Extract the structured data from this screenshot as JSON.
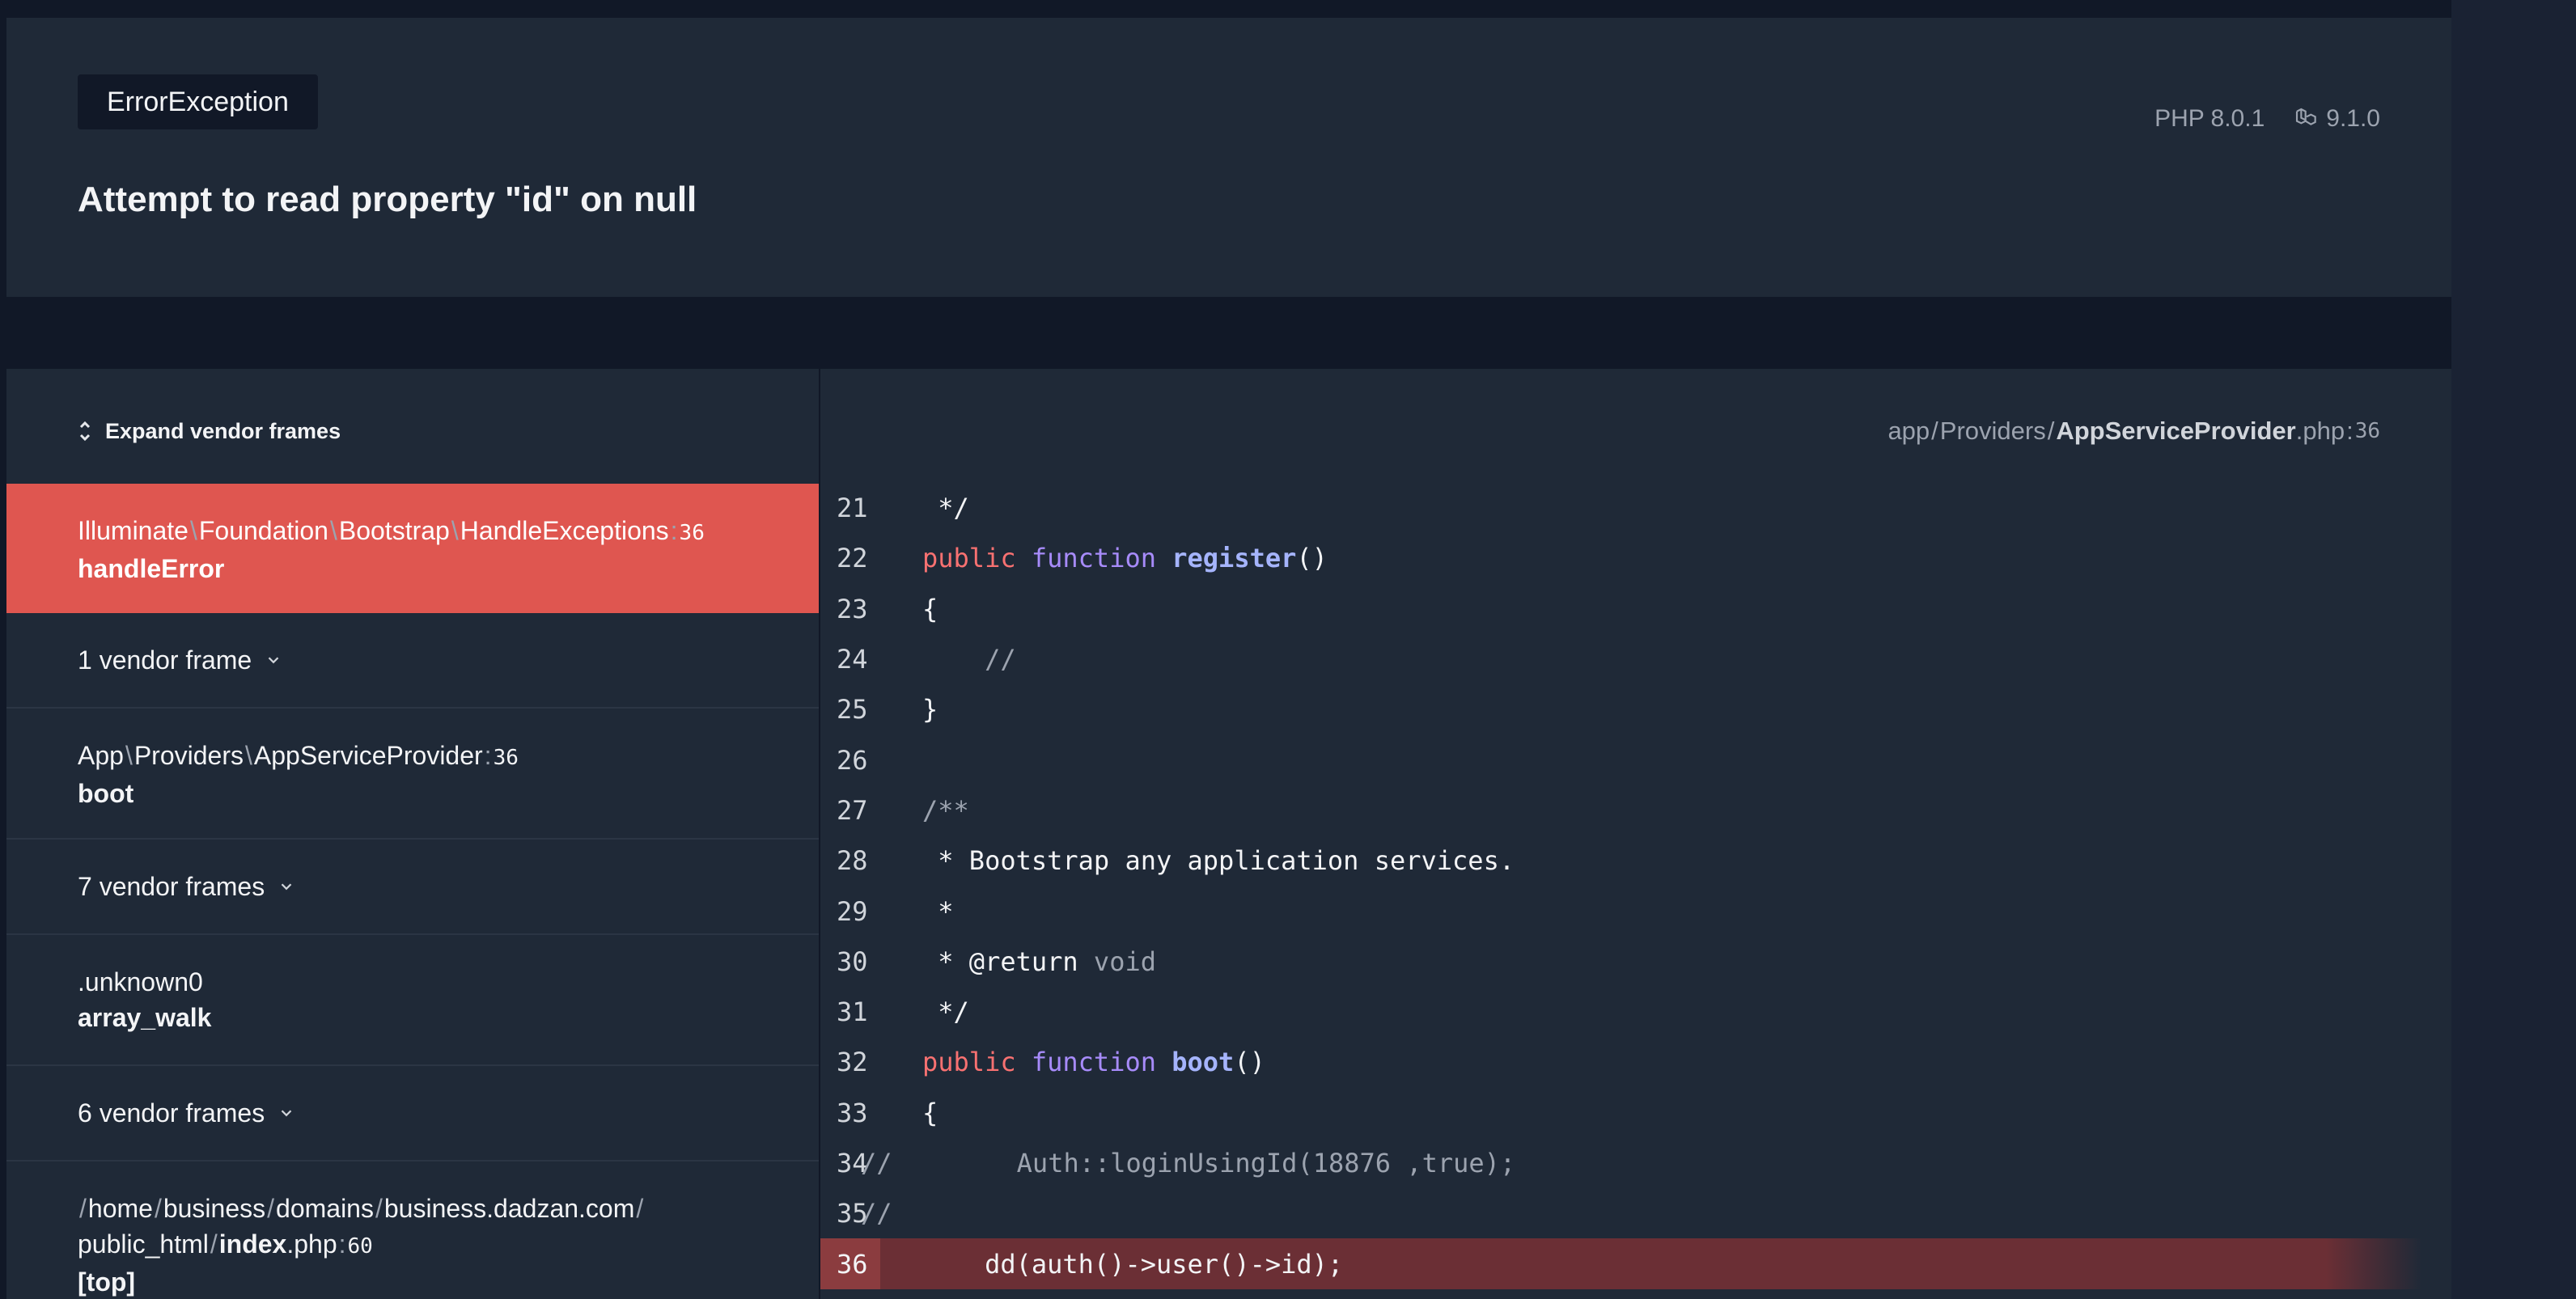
{
  "header": {
    "exception_class": "ErrorException",
    "message": "Attempt to read property \"id\" on null",
    "php_version": "PHP 8.0.1",
    "laravel_version": "9.1.0"
  },
  "sidebar": {
    "expand_label": "Expand vendor frames",
    "frames": {
      "active": {
        "path": [
          "Illuminate",
          "Foundation",
          "Bootstrap",
          "HandleExceptions"
        ],
        "line": "36",
        "method": "handleError"
      },
      "vendor1": "1 vendor frame",
      "provider": {
        "path": [
          "App",
          "Providers",
          "AppServiceProvider"
        ],
        "line": "36",
        "method": "boot"
      },
      "vendor2": "7 vendor frames",
      "unknown": {
        "name": ".unknown0",
        "method": "array_walk"
      },
      "vendor3": "6 vendor frames",
      "index": {
        "dir1": "home",
        "dir2": "business",
        "dir3": "domains",
        "dir4": "business.dadzan.com",
        "dir5": "public_html",
        "file": "index",
        "ext": ".php",
        "line": "60",
        "method": "[top]"
      }
    }
  },
  "code_panel": {
    "path": {
      "p1": "app",
      "p2": "Providers",
      "file": "AppServiceProvider",
      "ext": ".php",
      "line": "36"
    },
    "highlight_line": 36,
    "lines": [
      {
        "n": "21",
        "t": " */"
      },
      {
        "n": "22",
        "t": "public function register()"
      },
      {
        "n": "23",
        "t": "{"
      },
      {
        "n": "24",
        "t": "    //"
      },
      {
        "n": "25",
        "t": "}"
      },
      {
        "n": "26",
        "t": ""
      },
      {
        "n": "27",
        "t": "/**"
      },
      {
        "n": "28",
        "t": " * Bootstrap any application services."
      },
      {
        "n": "29",
        "t": " *"
      },
      {
        "n": "30",
        "t": " * @return void"
      },
      {
        "n": "31",
        "t": " */"
      },
      {
        "n": "32",
        "t": "public function boot()"
      },
      {
        "n": "33",
        "t": "{"
      },
      {
        "n": "34",
        "t": "//        Auth::loginUsingId(18876 ,true);"
      },
      {
        "n": "35",
        "t": "//"
      },
      {
        "n": "36",
        "t": "    dd(auth()->user()->id);"
      }
    ]
  },
  "colors": {
    "active_frame": "#df5650",
    "highlight_line": "#6b2f35",
    "background": "#111827",
    "panel": "#1f2937"
  },
  "icons": [
    "expand-icon",
    "chevron-down-icon",
    "laravel-icon"
  ]
}
